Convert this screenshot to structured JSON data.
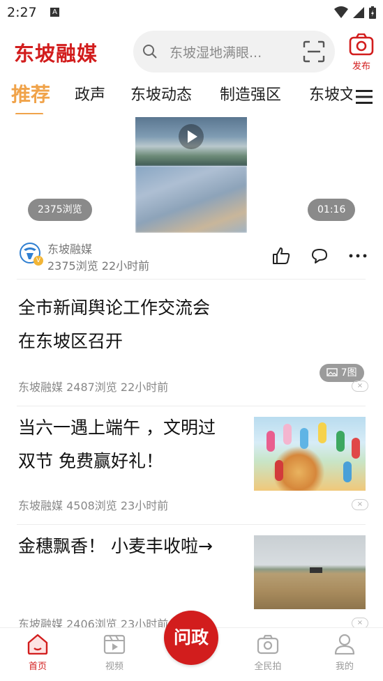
{
  "status_bar": {
    "time": "2:27",
    "notif_letter": "A"
  },
  "header": {
    "logo": "东坡融媒",
    "search_placeholder": "东坡湿地满眼...",
    "publish_label": "发布"
  },
  "tabs": [
    {
      "label": "推荐",
      "active": true
    },
    {
      "label": "政声"
    },
    {
      "label": "东坡动态"
    },
    {
      "label": "制造强区"
    },
    {
      "label": "东坡文"
    }
  ],
  "video_card": {
    "views_badge": "2375浏览",
    "duration": "01:16",
    "author": "东坡融媒",
    "meta": "2375浏览 22小时前",
    "verified_mark": "V"
  },
  "articles": [
    {
      "title_line1": "全市新闻舆论工作交流会",
      "title_line2": "在东坡区召开",
      "image_count": "7图",
      "meta": "东坡融媒 2487浏览 22小时前",
      "close": "×"
    },
    {
      "title_line1": "当六一遇上端午 ，文明过",
      "title_line2": "双节 免费赢好礼！",
      "meta": "东坡融媒 4508浏览 23小时前",
      "close": "×"
    },
    {
      "title_line1": "金穗飘香！ 小麦丰收啦→",
      "meta": "东坡融媒 2406浏览 23小时前",
      "close": "×"
    }
  ],
  "bottom_nav": {
    "home": "首页",
    "video": "视频",
    "center": "问政",
    "citizen": "全民拍",
    "mine": "我的"
  },
  "colors": {
    "brand_red": "#d21d1d",
    "tab_active": "#f0a34a"
  }
}
